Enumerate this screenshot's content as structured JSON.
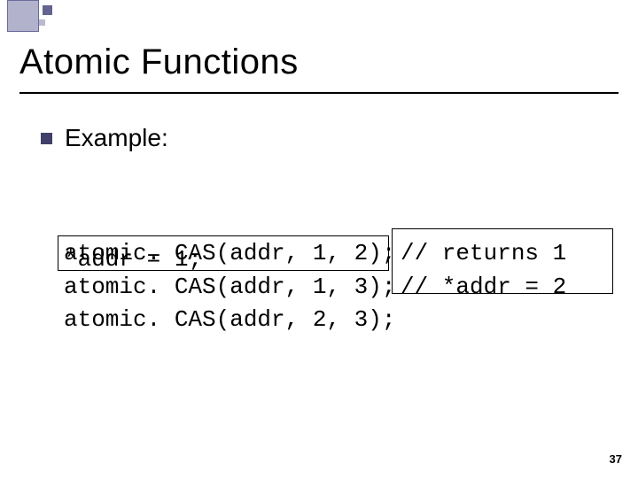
{
  "title": "Atomic Functions",
  "bullet": "Example:",
  "code_init": "*addr = 1;",
  "code_lines": [
    "atomic. CAS(addr, 1, 2);",
    "atomic. CAS(addr, 1, 3);",
    "atomic. CAS(addr, 2, 3);"
  ],
  "comments": [
    "// returns 1",
    "// *addr = 2"
  ],
  "page_number": "37"
}
